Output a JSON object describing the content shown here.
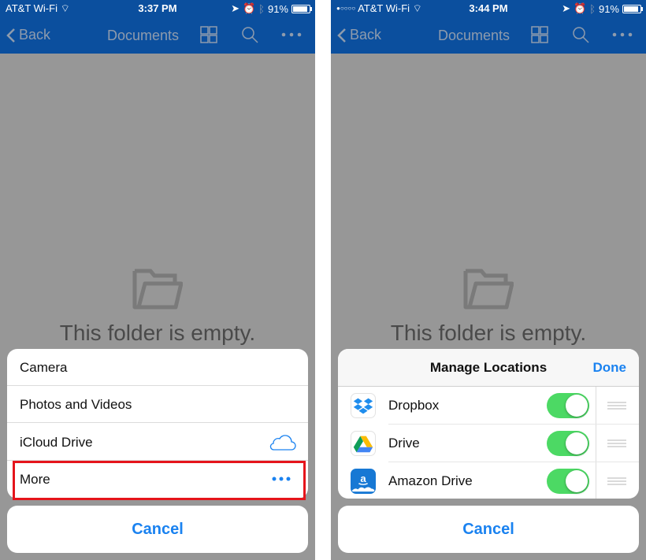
{
  "left_screen": {
    "status_bar": {
      "carrier": "AT&T Wi-Fi",
      "time": "3:37 PM",
      "battery": "91%",
      "battery_level": 0.91
    },
    "nav": {
      "back_label": "Back",
      "title": "Documents"
    },
    "empty_message": "This folder is empty.",
    "action_sheet": {
      "items": [
        {
          "label": "Camera"
        },
        {
          "label": "Photos and Videos"
        },
        {
          "label": "iCloud Drive",
          "icon": "cloud-icon"
        },
        {
          "label": "More",
          "icon": "ellipsis-icon",
          "highlighted": true
        }
      ],
      "cancel_label": "Cancel"
    }
  },
  "right_screen": {
    "status_bar": {
      "carrier": "AT&T Wi-Fi",
      "signal_dots": "●○○○○",
      "time": "3:44 PM",
      "battery": "91%",
      "battery_level": 0.91
    },
    "nav": {
      "back_label": "Back",
      "title": "Documents"
    },
    "empty_message": "This folder is empty.",
    "manage_locations": {
      "title": "Manage Locations",
      "done_label": "Done",
      "items": [
        {
          "label": "Dropbox",
          "icon": "dropbox-icon",
          "enabled": true
        },
        {
          "label": "Drive",
          "icon": "google-drive-icon",
          "enabled": true
        },
        {
          "label": "Amazon Drive",
          "icon": "amazon-drive-icon",
          "enabled": true
        }
      ]
    },
    "cancel_label": "Cancel"
  },
  "colors": {
    "nav_bar": "#0b4f9e",
    "accent_blue": "#1a82f0",
    "toggle_on": "#4cd964",
    "highlight_red": "#e5141b",
    "overlay": "#979797"
  }
}
